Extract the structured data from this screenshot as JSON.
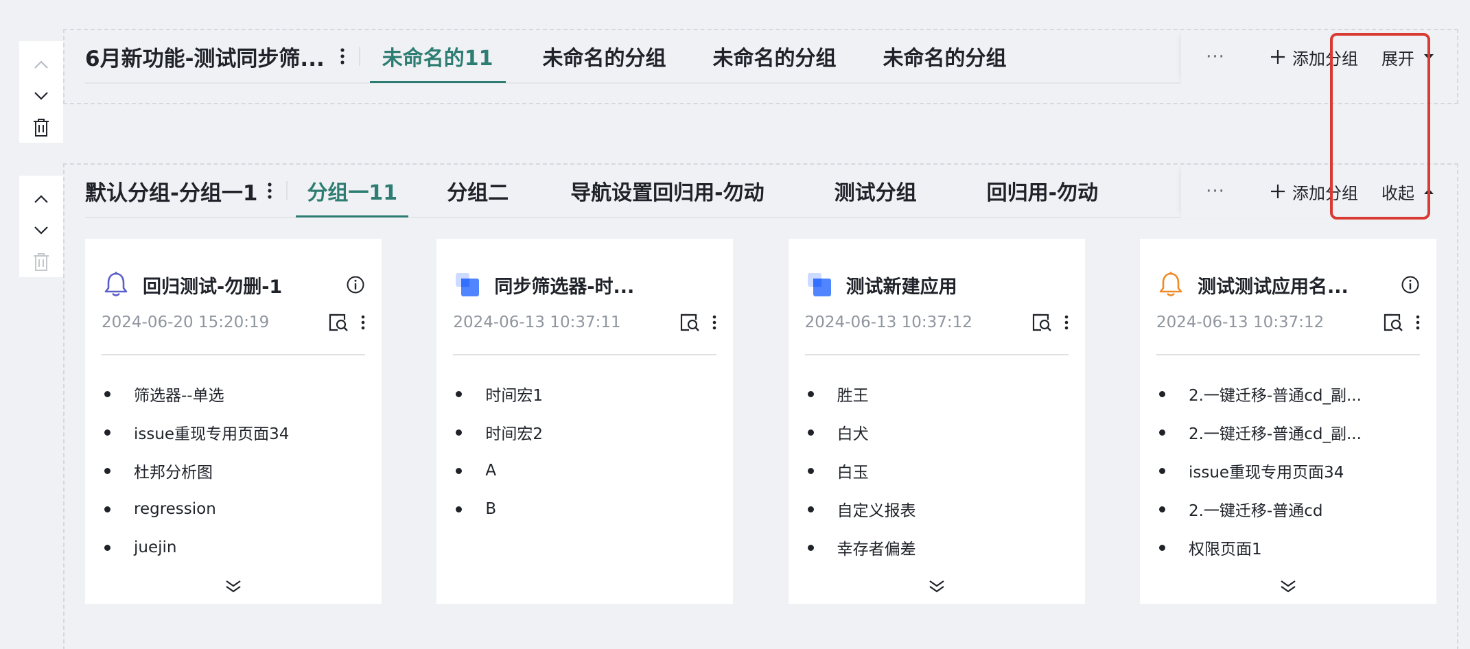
{
  "section1": {
    "title": "6月新功能-测试同步筛...",
    "tabs": [
      {
        "label": "未命名的11",
        "active": true
      },
      {
        "label": "未命名的分组",
        "active": false
      },
      {
        "label": "未命名的分组",
        "active": false
      },
      {
        "label": "未命名的分组",
        "active": false
      }
    ],
    "more": "···",
    "add_group": "添加分组",
    "toggle": "展开"
  },
  "section2": {
    "title": "默认分组-分组一1",
    "tabs": [
      {
        "label": "分组一11",
        "active": true
      },
      {
        "label": "分组二",
        "active": false
      },
      {
        "label": "导航设置回归用-勿动",
        "active": false
      },
      {
        "label": "测试分组",
        "active": false
      },
      {
        "label": "回归用-勿动",
        "active": false
      }
    ],
    "more": "···",
    "add_group": "添加分组",
    "toggle": "收起",
    "cards": [
      {
        "title": "回归测试-勿删-1",
        "icon": "bell-icon",
        "icon_color": "#5b5fc7",
        "date": "2024-06-20 15:20:19",
        "items": [
          "筛选器--单选",
          "issue重现专用页面34",
          "杜邦分析图",
          "regression",
          "juejin"
        ],
        "has_info": true,
        "has_expand": true
      },
      {
        "title": "同步筛选器-时...",
        "icon": "app-icon",
        "icon_color": "#3370ff",
        "date": "2024-06-13 10:37:11",
        "items": [
          "时间宏1",
          "时间宏2",
          "A",
          "B"
        ],
        "has_info": false,
        "has_expand": false
      },
      {
        "title": "测试新建应用",
        "icon": "app-icon",
        "icon_color": "#3370ff",
        "date": "2024-06-13 10:37:12",
        "items": [
          "胜王",
          "白犬",
          "白玉",
          "自定义报表",
          "幸存者偏差"
        ],
        "has_info": false,
        "has_expand": true
      },
      {
        "title": "测试测试应用名...",
        "icon": "bell-icon",
        "icon_color": "#f08a24",
        "date": "2024-06-13 10:37:12",
        "items": [
          "2.一键迁移-普通cd_副...",
          "2.一键迁移-普通cd_副...",
          "issue重现专用页面34",
          "2.一键迁移-普通cd",
          "权限页面1"
        ],
        "has_info": true,
        "has_expand": true
      }
    ]
  },
  "colors": {
    "accent": "#2e7d72",
    "highlight": "#d93a32",
    "background": "#f0f1f5"
  }
}
